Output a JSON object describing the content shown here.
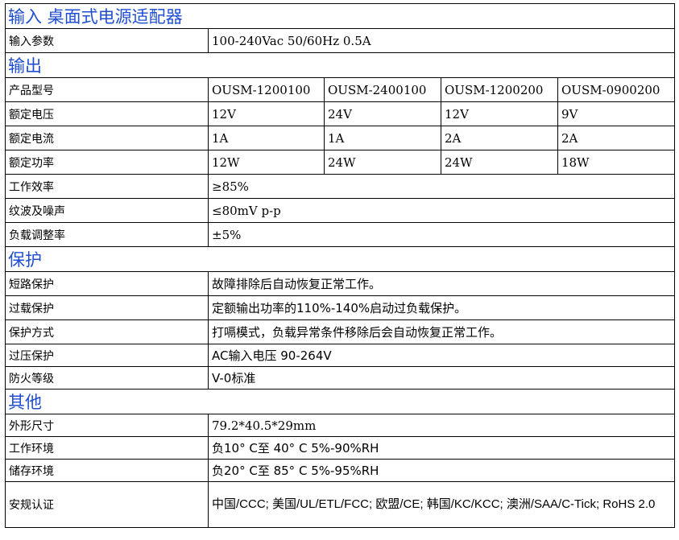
{
  "sections": {
    "input": "输入 桌面式电源适配器",
    "output": "输出",
    "protection": "保护",
    "other": "其他"
  },
  "input": {
    "label": "输入参数",
    "value": "100-240Vac 50/60Hz 0.5A"
  },
  "output": {
    "model_label": "产品型号",
    "models": [
      "OUSM-1200100",
      "OUSM-2400100",
      "OUSM-1200200",
      "OUSM-0900200"
    ],
    "voltage_label": "额定电压",
    "voltages": [
      "12V",
      "24V",
      "12V",
      "9V"
    ],
    "current_label": "额定电流",
    "currents": [
      "1A",
      "1A",
      "2A",
      "2A"
    ],
    "power_label": "额定功率",
    "powers": [
      "12W",
      "24W",
      "24W",
      "18W"
    ],
    "efficiency_label": "工作效率",
    "efficiency": "≥85%",
    "ripple_label": "纹波及噪声",
    "ripple": "≤80mV p-p",
    "load_reg_label": "负载调整率",
    "load_reg": "±5%"
  },
  "protection": {
    "short_label": "短路保护",
    "short": "故障排除后自动恢复正常工作。",
    "overload_label": "过载保护",
    "overload": "定额输出功率的110%-140%启动过负载保护。",
    "mode_label": "保护方式",
    "mode": "打嗝模式，负载异常条件移除后会自动恢复正常工作。",
    "overvoltage_label": "过压保护",
    "overvoltage": "AC输入电压 90-264V",
    "fire_label": "防火等级",
    "fire": "V-0标准"
  },
  "other": {
    "size_label": "外形尺寸",
    "size": "79.2*40.5*29mm",
    "operating_label": "工作环境",
    "operating": "负10° C至 40° C  5%-90%RH",
    "storage_label": "储存环境",
    "storage": "负20° C至 85° C  5%-95%RH",
    "cert_label": "安规认证",
    "cert": "中国/CCC; 美国/UL/ETL/FCC; 欧盟/CE; 韩国/KC/KCC; 澳洲/SAA/C-Tick; RoHS 2.0"
  },
  "colors": {
    "section_heading": "#1f4fd0",
    "border": "#000000"
  }
}
